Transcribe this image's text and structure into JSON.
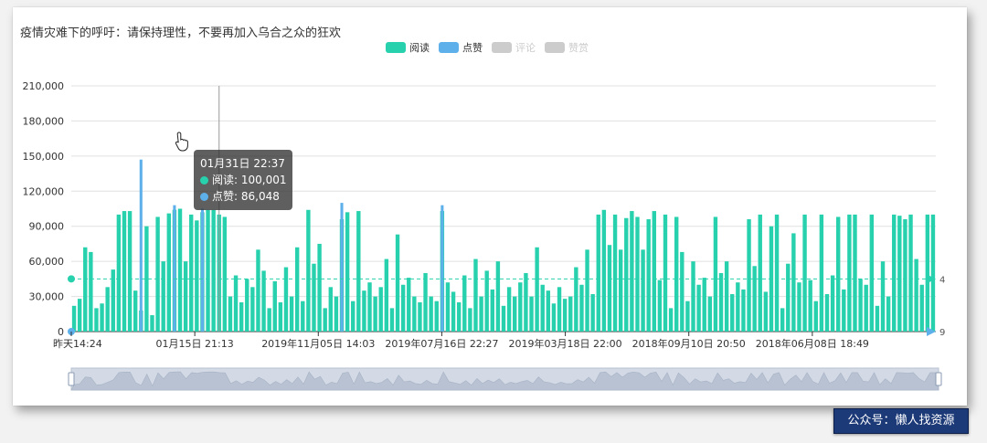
{
  "page": {
    "title": "疫情灾难下的呼吁：请保持理性，不要再加入乌合之众的狂欢",
    "watermark": "公众号：懒人找资源"
  },
  "legend": [
    {
      "label": "阅读",
      "color": "#27d1ad",
      "active": true
    },
    {
      "label": "点赞",
      "color": "#5eb0eb",
      "active": true
    },
    {
      "label": "评论",
      "color": "#cccccc",
      "active": false
    },
    {
      "label": "赞赏",
      "color": "#cccccc",
      "active": false
    }
  ],
  "tooltip": {
    "time": "01月31日 22:37",
    "rows": [
      {
        "label": "阅读: 100,001",
        "color": "#27d1ad"
      },
      {
        "label": "点赞: 86,048",
        "color": "#5eb0eb"
      }
    ]
  },
  "colors": {
    "read": "#27d1ad",
    "like": "#5eb0eb",
    "axis": "#333333",
    "grid": "#e0e0e0",
    "zoom": "#d3dae6"
  },
  "chart_data": {
    "type": "bar",
    "title": "疫情灾难下的呼吁：请保持理性，不要再加入乌合之众的狂欢",
    "ylim": [
      0,
      210000
    ],
    "yticks": [
      "0",
      "30,000",
      "60,000",
      "90,000",
      "120,000",
      "150,000",
      "180,000",
      "210,000"
    ],
    "xtick_labels": [
      "昨天14:24",
      "01月15日 21:13",
      "2019年11月05日 14:03",
      "2019年07月16日 22:27",
      "2019年03月18日 22:00",
      "2018年09月10日 20:50",
      "2018年06月08日 18:49"
    ],
    "average_read": 45000,
    "average_read_label": "4",
    "like_end_label": "9",
    "series": [
      {
        "name": "阅读",
        "color": "#27d1ad",
        "values": [
          22000,
          28000,
          72000,
          68000,
          20000,
          24000,
          38000,
          53000,
          100000,
          103000,
          103000,
          35000,
          18000,
          90000,
          14000,
          98000,
          60000,
          101000,
          104000,
          105000,
          60000,
          100000,
          95000,
          102000,
          104000,
          104000,
          100001,
          98000,
          30000,
          48000,
          25000,
          45000,
          38000,
          70000,
          52000,
          20000,
          43000,
          25000,
          55000,
          30000,
          72000,
          26000,
          104000,
          58000,
          75000,
          20000,
          38000,
          30000,
          96000,
          102000,
          26000,
          103000,
          35000,
          42000,
          30000,
          38000,
          62000,
          20000,
          83000,
          40000,
          46000,
          30000,
          25000,
          50000,
          30000,
          26000,
          103000,
          42000,
          34000,
          25000,
          48000,
          20000,
          62000,
          30000,
          52000,
          36000,
          60000,
          22000,
          38000,
          30000,
          42000,
          50000,
          30000,
          72000,
          40000,
          35000,
          24000,
          38000,
          28000,
          30000,
          55000,
          40000,
          70000,
          32000,
          100000,
          104000,
          74000,
          100000,
          70000,
          97000,
          103000,
          98000,
          70000,
          96000,
          103000,
          44000,
          100000,
          20000,
          98000,
          68000,
          26000,
          60000,
          40000,
          46000,
          30000,
          98000,
          50000,
          60000,
          32000,
          42000,
          36000,
          96000,
          56000,
          100000,
          34000,
          90000,
          100000,
          20000,
          58000,
          84000,
          42000,
          100000,
          44000,
          26000,
          100000,
          32000,
          48000,
          98000,
          36000,
          100000,
          100000,
          45000,
          40000,
          100000,
          22000,
          60000,
          30000,
          100000,
          99000,
          96000,
          100000,
          62000,
          40000,
          100000,
          100000
        ]
      },
      {
        "name": "点赞",
        "color": "#5eb0eb",
        "values": [
          8000,
          9000,
          18000,
          16000,
          7000,
          8000,
          12000,
          14000,
          22000,
          24000,
          24000,
          10000,
          147000,
          20000,
          5000,
          24000,
          16000,
          24000,
          108000,
          25000,
          16000,
          24000,
          23000,
          105000,
          25000,
          26000,
          86048,
          24000,
          9000,
          13000,
          8000,
          12000,
          11000,
          18000,
          14000,
          7000,
          12000,
          8000,
          14000,
          9000,
          18000,
          8000,
          26000,
          15000,
          19000,
          7000,
          11000,
          9000,
          110000,
          26000,
          8000,
          27000,
          10000,
          12000,
          9000,
          11000,
          16000,
          7000,
          21000,
          11000,
          12000,
          9000,
          8000,
          13000,
          9000,
          8000,
          108000,
          12000,
          10000,
          8000,
          13000,
          7000,
          16000,
          9000,
          14000,
          10000,
          16000,
          7000,
          11000,
          9000,
          12000,
          13000,
          9000,
          18000,
          11000,
          10000,
          8000,
          11000,
          8000,
          9000,
          15000,
          11000,
          18000,
          9000,
          25000,
          26000,
          19000,
          25000,
          18000,
          24000,
          26000,
          24000,
          18000,
          24000,
          26000,
          12000,
          25000,
          7000,
          24000,
          17000,
          8000,
          16000,
          11000,
          12000,
          9000,
          24000,
          13000,
          16000,
          9000,
          12000,
          10000,
          24000,
          15000,
          25000,
          10000,
          23000,
          25000,
          7000,
          15000,
          21000,
          12000,
          25000,
          12000,
          8000,
          25000,
          9000,
          13000,
          24000,
          10000,
          25000,
          25000,
          12000,
          11000,
          25000,
          7000,
          16000,
          9000,
          25000,
          25000,
          24000,
          25000,
          16000,
          11000,
          25000,
          25000
        ]
      }
    ]
  }
}
